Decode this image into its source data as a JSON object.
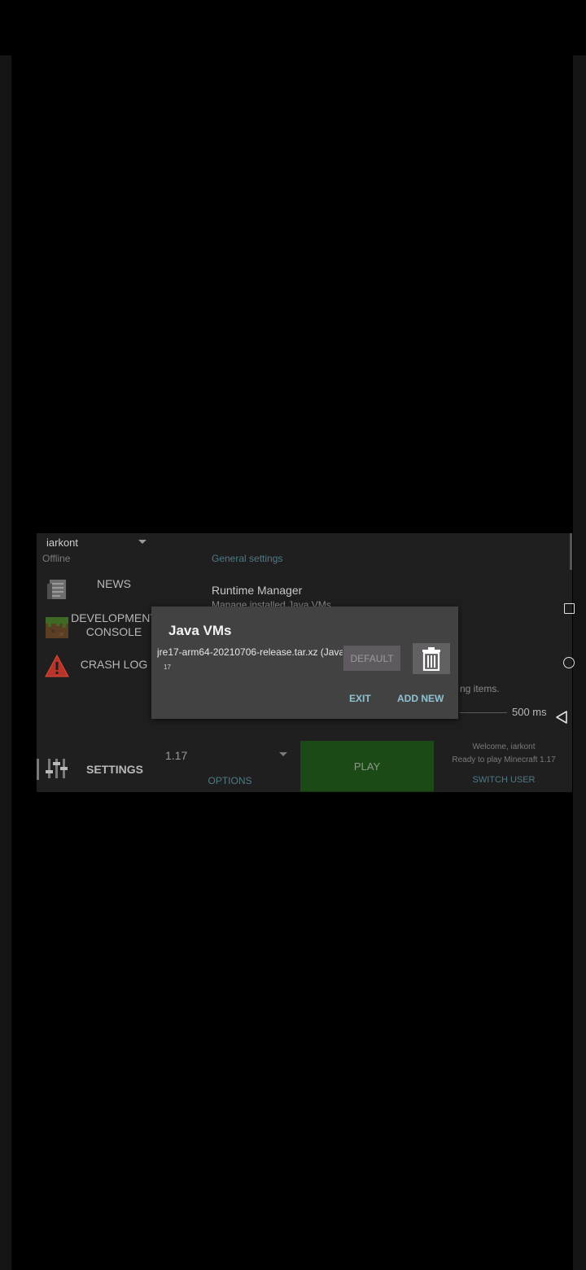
{
  "account": {
    "name": "iarkont",
    "status": "Offline"
  },
  "sidebar": {
    "items": [
      {
        "label": "NEWS"
      },
      {
        "label_line1": "DEVELOPMENT",
        "label_line2": "CONSOLE"
      },
      {
        "label": "CRASH LOG"
      }
    ]
  },
  "settings": {
    "header": "General settings",
    "runtime_title": "Runtime Manager",
    "runtime_summary": "Manage installed Java VMs",
    "partial_text": "ng items.",
    "slider_value": "500 ms"
  },
  "bottom_bar": {
    "settings_label": "SETTINGS",
    "version": "1.17",
    "options_label": "OPTIONS",
    "play_label": "PLAY",
    "welcome": "Welcome, iarkont",
    "ready": "Ready to play Minecraft 1.17",
    "switch_user": "SWITCH USER"
  },
  "dialog": {
    "title": "Java VMs",
    "vm_name": "jre17-arm64-20210706-release.tar.xz (Java",
    "vm_version": "17",
    "default_label": "DEFAULT",
    "exit_label": "EXIT",
    "add_new_label": "ADD NEW"
  },
  "icons": {
    "news": "newspaper-icon",
    "dev_console": "grass-block-icon",
    "crash_log": "warning-icon",
    "settings": "sliders-icon",
    "delete": "trash-icon"
  },
  "colors": {
    "accent": "#8fc2d1",
    "play": "#1c4a16",
    "warning": "#d23a2a"
  }
}
